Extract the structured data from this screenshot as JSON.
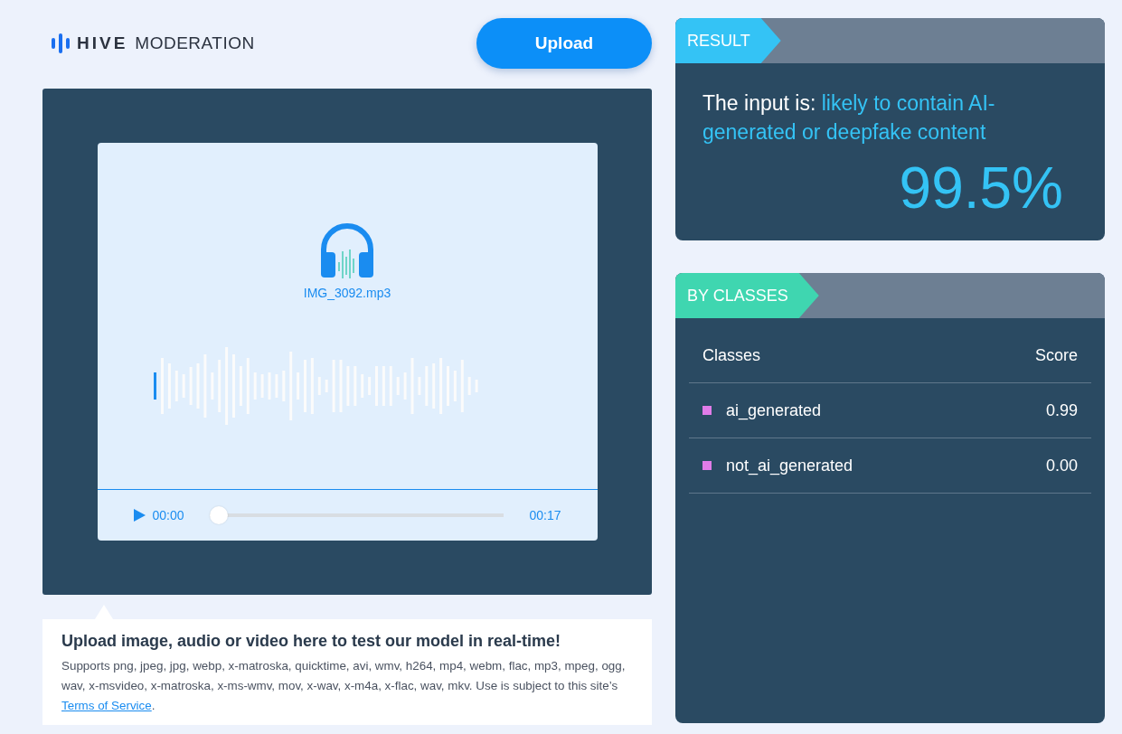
{
  "logo": {
    "brand": "HIVE",
    "product": "MODERATION"
  },
  "upload_button": {
    "label": "Upload"
  },
  "player": {
    "file_name": "IMG_3092.mp3",
    "current_time": "00:00",
    "duration": "00:17",
    "level": 0
  },
  "info": {
    "title": "Upload image, audio or video here to test our model in real-time!",
    "body": "Supports png, jpeg, jpg, webp, x-matroska, quicktime, avi, wmv, h264, mp4, webm, flac, mp3, mpeg, ogg, wav, x-msvideo, x-matroska, x-ms-wmv, mov, x-wav, x-m4a, x-flac, wav, mkv. Use is subject to this site’s ",
    "link": "Terms of Service",
    "tail": "."
  },
  "result": {
    "tag": "RESULT",
    "label": "The input is: ",
    "verdict": "likely to contain AI-generated or deepfake content",
    "score": "99.5%"
  },
  "classes": {
    "tag": "BY CLASSES",
    "columns": [
      "Classes",
      "Score"
    ],
    "rows": [
      {
        "name": "ai_generated",
        "score": "0.99",
        "color": "#e07ce8"
      },
      {
        "name": "not_ai_generated",
        "score": "0.00",
        "color": "#e07ce8"
      }
    ]
  }
}
